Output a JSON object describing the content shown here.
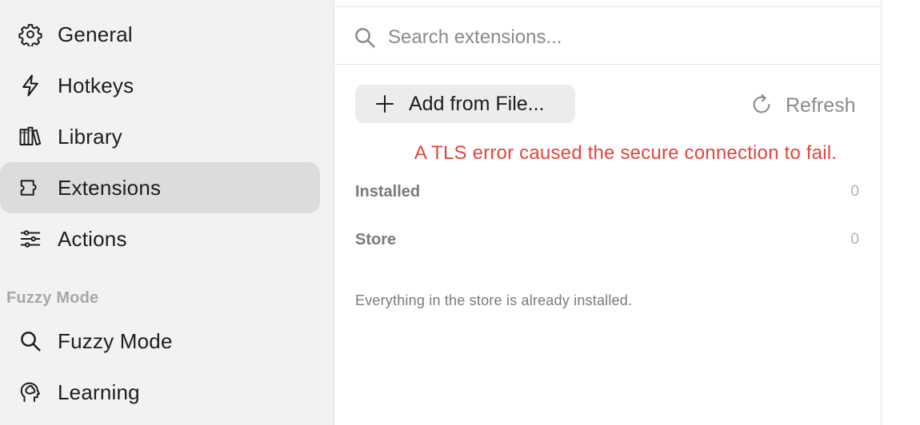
{
  "sidebar": {
    "items": [
      {
        "label": "General",
        "icon": "gear-icon"
      },
      {
        "label": "Hotkeys",
        "icon": "bolt-icon"
      },
      {
        "label": "Library",
        "icon": "books-icon"
      },
      {
        "label": "Extensions",
        "icon": "puzzle-icon",
        "active": true
      },
      {
        "label": "Actions",
        "icon": "sliders-icon"
      }
    ],
    "section_title": "Fuzzy Mode",
    "section_items": [
      {
        "label": "Fuzzy Mode",
        "icon": "search-icon"
      },
      {
        "label": "Learning",
        "icon": "brain-icon"
      }
    ]
  },
  "main": {
    "search": {
      "placeholder": "Search extensions...",
      "value": ""
    },
    "add_button": "Add from File...",
    "refresh_button": "Refresh",
    "error_message": "A TLS error caused the secure connection to fail.",
    "sections": [
      {
        "name": "Installed",
        "count": "0"
      },
      {
        "name": "Store",
        "count": "0"
      }
    ],
    "note": "Everything in the store is already installed."
  },
  "colors": {
    "sidebar_bg": "#f2f2f2",
    "active_item_bg": "#dcdcdc",
    "error": "#e0443e",
    "button_bg": "#ececec"
  }
}
